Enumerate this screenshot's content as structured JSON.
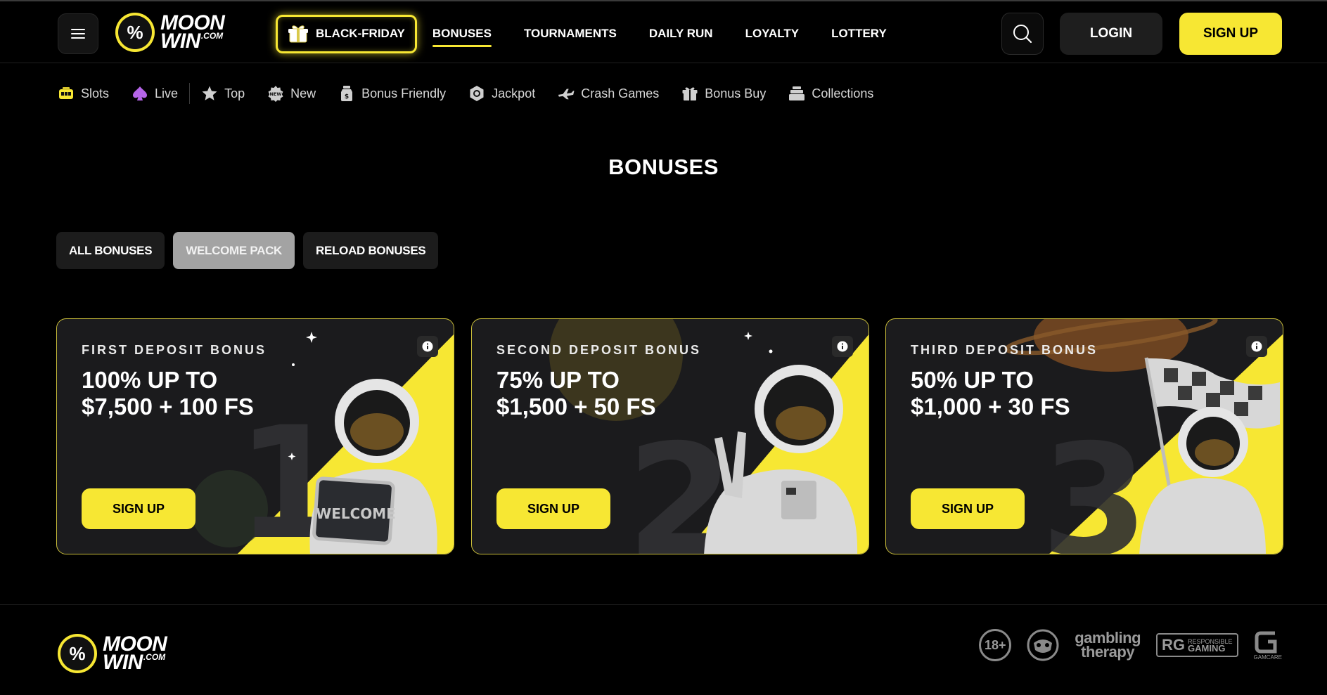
{
  "header": {
    "logo": {
      "line1": "MOON",
      "line2": "WIN",
      "suffix": ".COM",
      "symbol": "%"
    },
    "promo_label": "BLACK-FRIDAY",
    "nav": [
      {
        "label": "BONUSES",
        "active": true
      },
      {
        "label": "TOURNAMENTS"
      },
      {
        "label": "DAILY RUN"
      },
      {
        "label": "LOYALTY"
      },
      {
        "label": "LOTTERY"
      }
    ],
    "login_label": "LOGIN",
    "signup_label": "SIGN UP"
  },
  "categories": [
    {
      "label": "Slots",
      "icon": "slot-machine-icon"
    },
    {
      "label": "Live",
      "icon": "spade-icon"
    },
    {
      "label": "Top",
      "icon": "star-icon"
    },
    {
      "label": "New",
      "icon": "new-badge-icon"
    },
    {
      "label": "Bonus Friendly",
      "icon": "money-jar-icon"
    },
    {
      "label": "Jackpot",
      "icon": "jackpot-icon"
    },
    {
      "label": "Crash Games",
      "icon": "plane-icon"
    },
    {
      "label": "Bonus Buy",
      "icon": "gift-icon"
    },
    {
      "label": "Collections",
      "icon": "stack-icon"
    }
  ],
  "page_title": "BONUSES",
  "filters": [
    {
      "label": "ALL BONUSES"
    },
    {
      "label": "WELCOME PACK",
      "active": true
    },
    {
      "label": "RELOAD BONUSES"
    }
  ],
  "cards": [
    {
      "eyebrow": "FIRST DEPOSIT BONUS",
      "line1": "100% UP TO",
      "line2": "$7,500 + 100 FS",
      "cta": "SIGN UP",
      "number": "1",
      "sign_text": "WELCOME"
    },
    {
      "eyebrow": "SECOND DEPOSIT BONUS",
      "line1": "75% UP TO",
      "line2": "$1,500 + 50 FS",
      "cta": "SIGN UP",
      "number": "2"
    },
    {
      "eyebrow": "THIRD DEPOSIT BONUS",
      "line1": "50% UP TO",
      "line2": "$1,000 + 30 FS",
      "cta": "SIGN UP",
      "number": "3"
    }
  ],
  "footer": {
    "logo": {
      "line1": "MOON",
      "line2": "WIN",
      "suffix": ".COM",
      "symbol": "%"
    },
    "badges": {
      "age": "18+",
      "gambling_therapy_line1": "gambling",
      "gambling_therapy_line2": "therapy",
      "responsible_gaming_mark": "RG",
      "responsible_gaming_line1": "RESPONSIBLE",
      "responsible_gaming_line2": "GAMING",
      "gamcare": "GAMCARE"
    }
  },
  "colors": {
    "accent": "#f7e733",
    "background": "#000000",
    "card_bg": "#1b1b1d",
    "card_border": "#c9bd3a"
  }
}
